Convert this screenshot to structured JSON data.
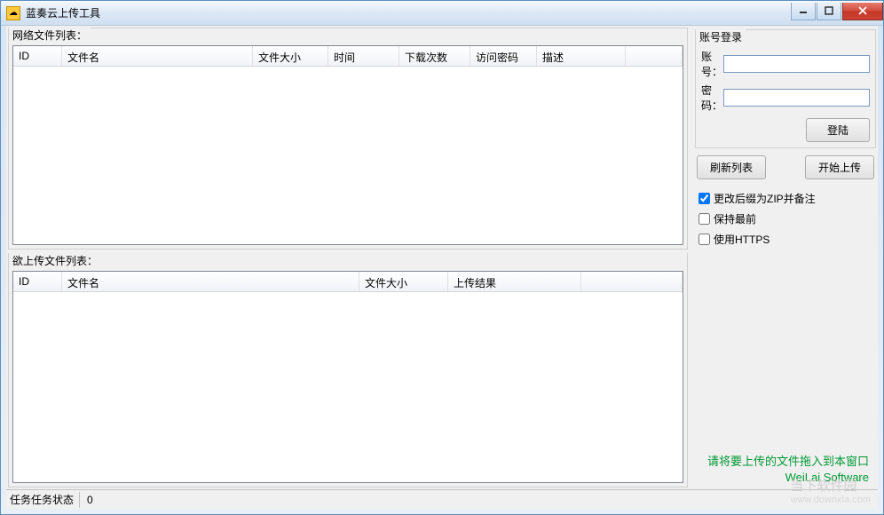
{
  "window": {
    "title": "蓝奏云上传工具"
  },
  "groups": {
    "network_list": "网络文件列表：",
    "upload_list": "欲上传文件列表：",
    "login": "账号登录"
  },
  "network_table": {
    "columns": [
      "ID",
      "文件名",
      "文件大小",
      "时间",
      "下载次数",
      "访问密码",
      "描述"
    ],
    "rows": []
  },
  "upload_table": {
    "columns": [
      "ID",
      "文件名",
      "文件大小",
      "上传结果"
    ],
    "rows": []
  },
  "login": {
    "account_label": "账号：",
    "password_label": "密码：",
    "account_value": "",
    "password_value": "",
    "login_btn": "登陆"
  },
  "actions": {
    "refresh": "刷新列表",
    "start_upload": "开始上传"
  },
  "options": {
    "zip_suffix": {
      "label": "更改后缀为ZIP并备注",
      "checked": true
    },
    "keep_top": {
      "label": "保持最前",
      "checked": false
    },
    "use_https": {
      "label": "使用HTTPS",
      "checked": false
    }
  },
  "hint": {
    "line1": "请将要上传的文件拖入到本窗口",
    "line2": "WeiLai Software"
  },
  "status": {
    "label": "任务任务状态",
    "value": "0"
  },
  "watermark": {
    "name": "当下软件园",
    "url": "www.downxia.com"
  }
}
